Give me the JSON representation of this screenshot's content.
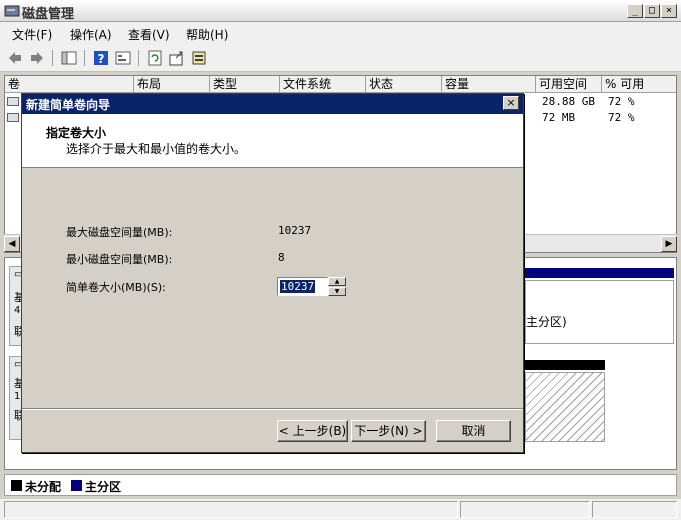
{
  "window": {
    "title": "磁盘管理"
  },
  "menu": {
    "items": [
      "文件(F)",
      "操作(A)",
      "查看(V)",
      "帮助(H)"
    ]
  },
  "toolbar": {
    "icons": [
      "back-icon",
      "forward-icon",
      "console-tree-icon",
      "help-icon",
      "properties-icon",
      "refresh-icon",
      "export-icon",
      "settings-icon"
    ]
  },
  "volume_list": {
    "columns": [
      "卷",
      "布局",
      "类型",
      "文件系统",
      "状态",
      "容量",
      "可用空间",
      "% 可用"
    ],
    "rows": [
      {
        "free": "28.88 GB",
        "pct": "72 %"
      },
      {
        "free": "72 MB",
        "pct": "72 %"
      }
    ]
  },
  "disk_pane": {
    "disk0": {
      "label_frag": [
        "基",
        "40",
        "联"
      ]
    },
    "disk1": {
      "label_frag": [
        "基",
        "10",
        "联"
      ]
    },
    "partition_text": "主分区)"
  },
  "legend": {
    "unallocated": "未分配",
    "primary": "主分区",
    "unallocated_color": "#000000",
    "primary_color": "#000080"
  },
  "dialog": {
    "title": "新建简单卷向导",
    "heading": "指定卷大小",
    "subtitle": "选择介于最大和最小值的卷大小。",
    "max_label": "最大磁盘空间量(MB):",
    "max_value": "10237",
    "min_label": "最小磁盘空间量(MB):",
    "min_value": "8",
    "size_label": "简单卷大小(MB)(S):",
    "size_value": "10237",
    "back_button": "< 上一步(B)",
    "next_button": "下一步(N) >",
    "cancel_button": "取消"
  }
}
